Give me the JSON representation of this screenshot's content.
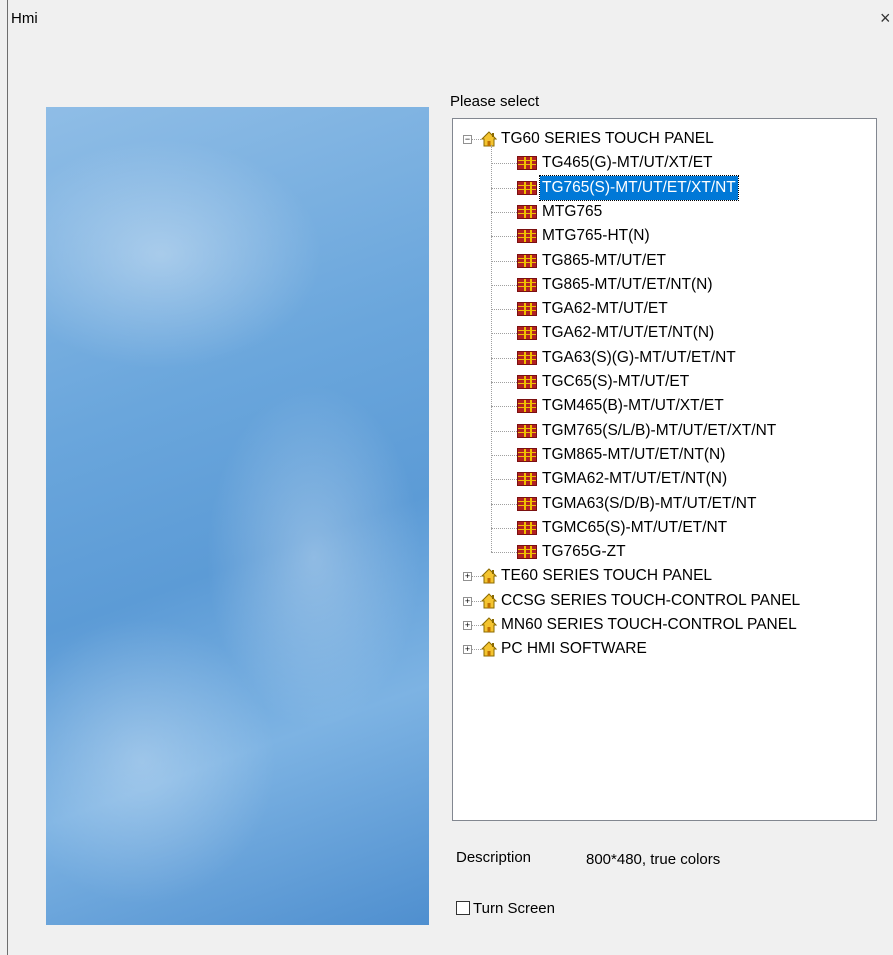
{
  "window": {
    "title": "Hmi",
    "close_glyph": "×"
  },
  "prompt": "Please select",
  "tree": {
    "groups": [
      {
        "label": "TG60 SERIES TOUCH PANEL",
        "expanded": true,
        "icon": "house-icon",
        "items": [
          {
            "label": "TG465(G)-MT/UT/XT/ET",
            "selected": false
          },
          {
            "label": "TG765(S)-MT/UT/ET/XT/NT",
            "selected": true
          },
          {
            "label": "MTG765",
            "selected": false
          },
          {
            "label": "MTG765-HT(N)",
            "selected": false
          },
          {
            "label": "TG865-MT/UT/ET",
            "selected": false
          },
          {
            "label": "TG865-MT/UT/ET/NT(N)",
            "selected": false
          },
          {
            "label": "TGA62-MT/UT/ET",
            "selected": false
          },
          {
            "label": "TGA62-MT/UT/ET/NT(N)",
            "selected": false
          },
          {
            "label": "TGA63(S)(G)-MT/UT/ET/NT",
            "selected": false
          },
          {
            "label": "TGC65(S)-MT/UT/ET",
            "selected": false
          },
          {
            "label": "TGM465(B)-MT/UT/XT/ET",
            "selected": false
          },
          {
            "label": "TGM765(S/L/B)-MT/UT/ET/XT/NT",
            "selected": false
          },
          {
            "label": "TGM865-MT/UT/ET/NT(N)",
            "selected": false
          },
          {
            "label": "TGMA62-MT/UT/ET/NT(N)",
            "selected": false
          },
          {
            "label": "TGMA63(S/D/B)-MT/UT/ET/NT",
            "selected": false
          },
          {
            "label": "TGMC65(S)-MT/UT/ET/NT",
            "selected": false
          },
          {
            "label": "TG765G-ZT",
            "selected": false
          }
        ]
      },
      {
        "label": "TE60 SERIES TOUCH PANEL",
        "expanded": false,
        "icon": "house-icon",
        "items": []
      },
      {
        "label": "CCSG SERIES TOUCH-CONTROL PANEL",
        "expanded": false,
        "icon": "house-icon",
        "items": []
      },
      {
        "label": "MN60 SERIES TOUCH-CONTROL PANEL",
        "expanded": false,
        "icon": "house-icon",
        "items": []
      },
      {
        "label": "PC HMI SOFTWARE",
        "expanded": false,
        "icon": "house-icon",
        "items": []
      }
    ]
  },
  "description": {
    "label": "Description",
    "value": "800*480, true colors"
  },
  "turn_screen": {
    "label": "Turn Screen",
    "checked": false
  },
  "colors": {
    "selection": "#0078d7",
    "background": "#f0f0f0"
  }
}
